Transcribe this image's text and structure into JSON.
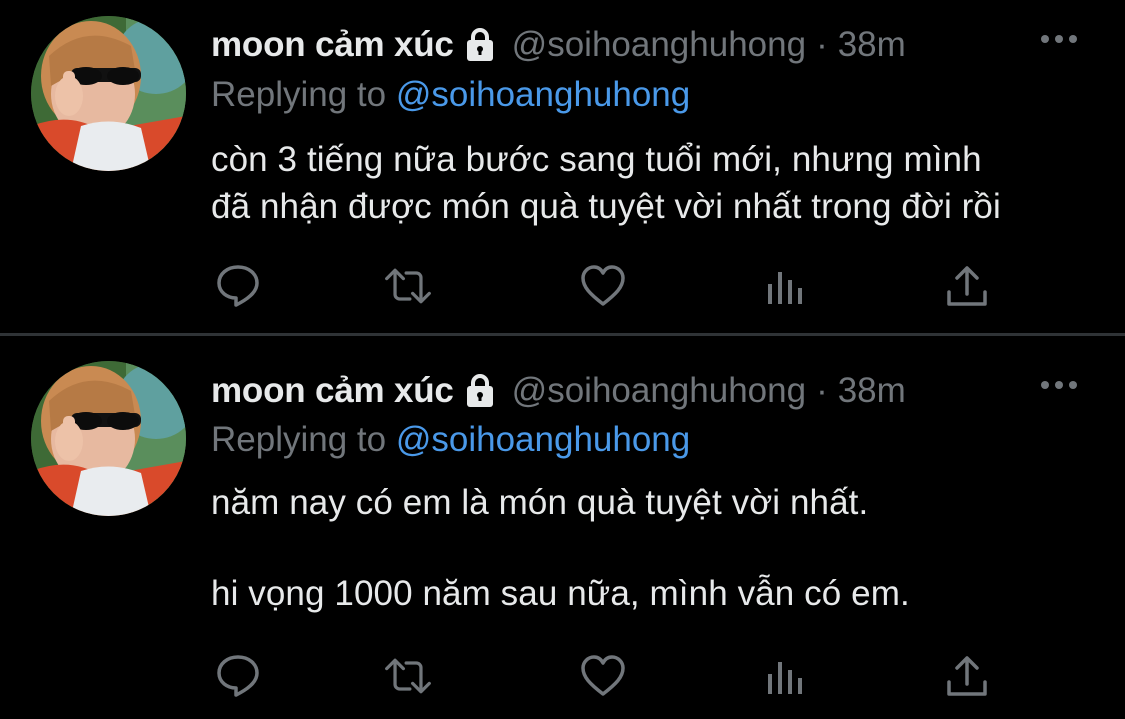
{
  "colors": {
    "background": "#000000",
    "text_primary": "#e7e9ea",
    "text_secondary": "#71767b",
    "mention": "#4a99e9",
    "divider": "#2f3336"
  },
  "tweets": [
    {
      "display_name": "moon cảm xúc",
      "protected_icon": "lock-icon",
      "handle": "@soihoanghuhong",
      "separator": "·",
      "time": "38m",
      "reply_prefix": "Replying to",
      "reply_to": "@soihoanghuhong",
      "text_lines": [
        "còn 3 tiếng nữa bước sang tuổi mới, nhưng mình",
        "đã nhận được món quà tuyệt vời nhất trong đời rồi"
      ],
      "actions": [
        "reply-icon",
        "retweet-icon",
        "like-icon",
        "analytics-icon",
        "share-icon"
      ]
    },
    {
      "display_name": "moon cảm xúc",
      "protected_icon": "lock-icon",
      "handle": "@soihoanghuhong",
      "separator": "·",
      "time": "38m",
      "reply_prefix": "Replying to",
      "reply_to": "@soihoanghuhong",
      "text_lines": [
        "năm nay có em là món quà tuyệt vời nhất.",
        "hi vọng 1000 năm sau nữa, mình vẫn có em."
      ],
      "actions": [
        "reply-icon",
        "retweet-icon",
        "like-icon",
        "analytics-icon",
        "share-icon"
      ]
    }
  ]
}
